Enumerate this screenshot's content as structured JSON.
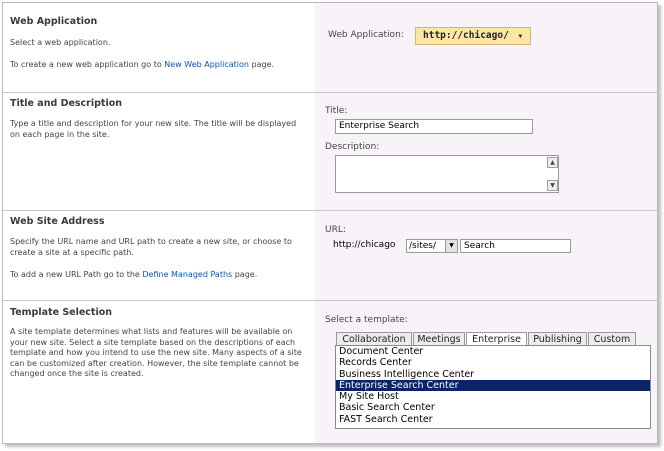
{
  "web_application": {
    "title": "Web Application",
    "description": "Select a web application.",
    "create_prefix": "To create a new web application go to ",
    "create_link": "New Web Application",
    "create_suffix": " page.",
    "selector_label": "Web Application:",
    "selected_value": "http://chicago/"
  },
  "title_description": {
    "title": "Title and Description",
    "description": "Type a title and description for your new site. The title will be displayed on each page in the site.",
    "title_label": "Title:",
    "title_value": "Enterprise Search",
    "description_label": "Description:",
    "description_value": ""
  },
  "web_site_address": {
    "title": "Web Site Address",
    "description": "Specify the URL name and URL path to create a new site, or choose to create a site at a specific path.",
    "path_prefix": "To add a new URL Path go to the ",
    "path_link": "Define Managed Paths",
    "path_suffix": " page.",
    "url_label": "URL:",
    "url_host": "http://chicago",
    "url_path_selected": "/sites/",
    "url_name": "Search"
  },
  "template_selection": {
    "title": "Template Selection",
    "description": "A site template determines what lists and features will be available on your new site. Select a site template based on the descriptions of each template and how you intend to use the new site. Many aspects of a site can be customized after creation. However, the site template cannot be changed once the site is created.",
    "select_label": "Select a template:",
    "tabs": [
      "Collaboration",
      "Meetings",
      "Enterprise",
      "Publishing",
      "Custom"
    ],
    "active_tab": "Enterprise",
    "templates": [
      "Document Center",
      "Records Center",
      "Business Intelligence Center",
      "Enterprise Search Center",
      "My Site Host",
      "Basic Search Center",
      "FAST Search Center"
    ],
    "selected_template": "Enterprise Search Center"
  }
}
